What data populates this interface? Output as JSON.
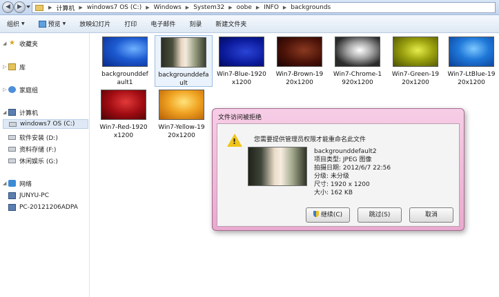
{
  "address": {
    "crumbs": [
      "计算机",
      "windows7 OS (C:)",
      "Windows",
      "System32",
      "oobe",
      "INFO",
      "backgrounds"
    ]
  },
  "toolbar": {
    "organize": "组织",
    "preview": "预览",
    "slideshow": "放映幻灯片",
    "print": "打印",
    "email": "电子邮件",
    "burn": "刻录",
    "new_folder": "新建文件夹"
  },
  "sidebar": {
    "favorites": "收藏夹",
    "libraries": "库",
    "homegroup": "家庭组",
    "computer": "计算机",
    "drive_c": "windows7 OS (C:)",
    "drive_d": "软件安装 (D:)",
    "drive_f": "资料存储 (F:)",
    "drive_g": "休闲娱乐 (G:)",
    "network": "网络",
    "net_1": "JUNYU-PC",
    "net_2": "PC-20121206ADPA"
  },
  "files": [
    {
      "line1": "backgrounddef",
      "line2": "ault1",
      "thumb": "blue-icon"
    },
    {
      "line1": "backgrounddefa",
      "line2": "ult",
      "thumb": "photo"
    },
    {
      "line1": "Win7-Blue-1920",
      "line2": "x1200",
      "thumb": "blue"
    },
    {
      "line1": "Win7-Brown-19",
      "line2": "20x1200",
      "thumb": "brown"
    },
    {
      "line1": "Win7-Chrome-1",
      "line2": "920x1200",
      "thumb": "chrome"
    },
    {
      "line1": "Win7-Green-19",
      "line2": "20x1200",
      "thumb": "green"
    },
    {
      "line1": "Win7-LtBlue-19",
      "line2": "20x1200",
      "thumb": "ltblue"
    },
    {
      "line1": "Win7-Red-1920",
      "line2": "x1200",
      "thumb": "red"
    },
    {
      "line1": "Win7-Yellow-19",
      "line2": "20x1200",
      "thumb": "yellow"
    }
  ],
  "dialog": {
    "title": "文件访问被拒绝",
    "message": "您需要提供管理员权限才能重命名此文件",
    "file_name": "backgrounddefault2",
    "type": "项目类型: JPEG 图像",
    "date": "拍摄日期: 2012/6/7 22:56",
    "rating": "分级: 未分级",
    "dimensions": "尺寸: 1920 x 1200",
    "size": "大小: 162 KB",
    "continue_label": "继续(C)",
    "skip_label": "跳过(S)",
    "cancel_label": "取消"
  }
}
